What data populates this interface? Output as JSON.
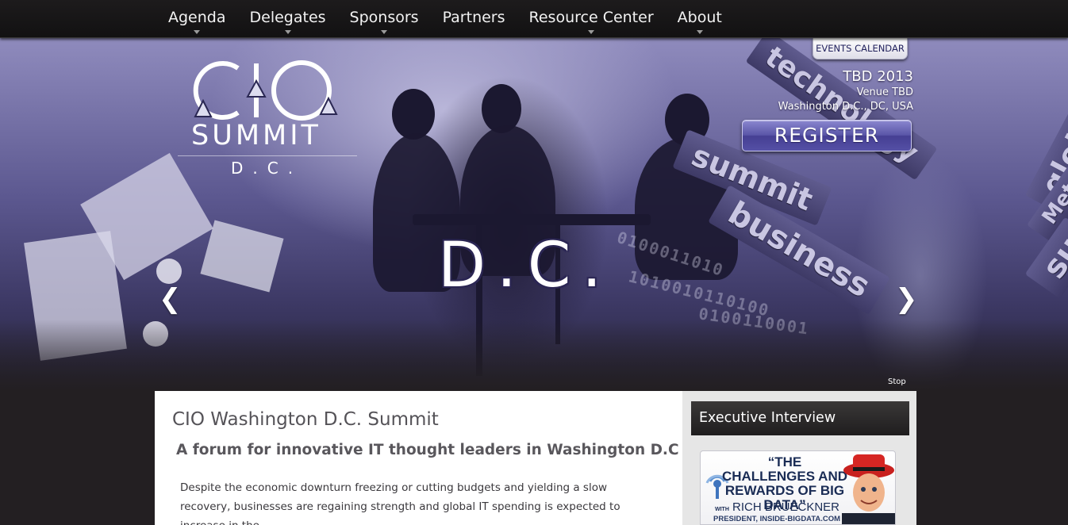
{
  "nav": {
    "items": [
      {
        "label": "Agenda",
        "dropdown": true
      },
      {
        "label": "Delegates",
        "dropdown": true
      },
      {
        "label": "Sponsors",
        "dropdown": true
      },
      {
        "label": "Partners",
        "dropdown": false
      },
      {
        "label": "Resource Center",
        "dropdown": true
      },
      {
        "label": "About",
        "dropdown": true
      }
    ]
  },
  "hero": {
    "logo": {
      "cio": "CIO",
      "summit": "SUMMIT",
      "dc": "D.C."
    },
    "slide_text": "D.C.",
    "sign_words": [
      "technology",
      "summit",
      "business",
      "global",
      "Met",
      "su"
    ],
    "binary": [
      "0100011010",
      "1010010110100",
      "0100110001"
    ],
    "prev_arrow": "❮",
    "next_arrow": "❯",
    "stop_label": "Stop",
    "events_calendar_label": "EVENTS CALENDAR",
    "event": {
      "date": "TBD 2013",
      "venue": "Venue TBD",
      "location": "Washington D.C., DC, USA"
    },
    "register_label": "REGISTER"
  },
  "main": {
    "title": "CIO Washington D.C. Summit",
    "subtitle": "A forum for innovative IT thought leaders in Washington D.C",
    "body": "Despite the economic downturn freezing or cutting budgets and yielding a slow recovery, businesses are regaining strength and global IT spending is expected to increase in the"
  },
  "sidebar": {
    "box_title": "Executive Interview",
    "interview": {
      "headline": "“THE CHALLENGES AND REWARDS OF BIG DATA”",
      "with": "WITH",
      "name": "RICH BRUECKNER",
      "title": "PRESIDENT, INSIDE-BIGDATA.COM"
    }
  },
  "colors": {
    "nav_bg": "#151314",
    "hero_tint": "#5c5890",
    "register": "#5a56a8",
    "page_bg": "#231f22"
  }
}
